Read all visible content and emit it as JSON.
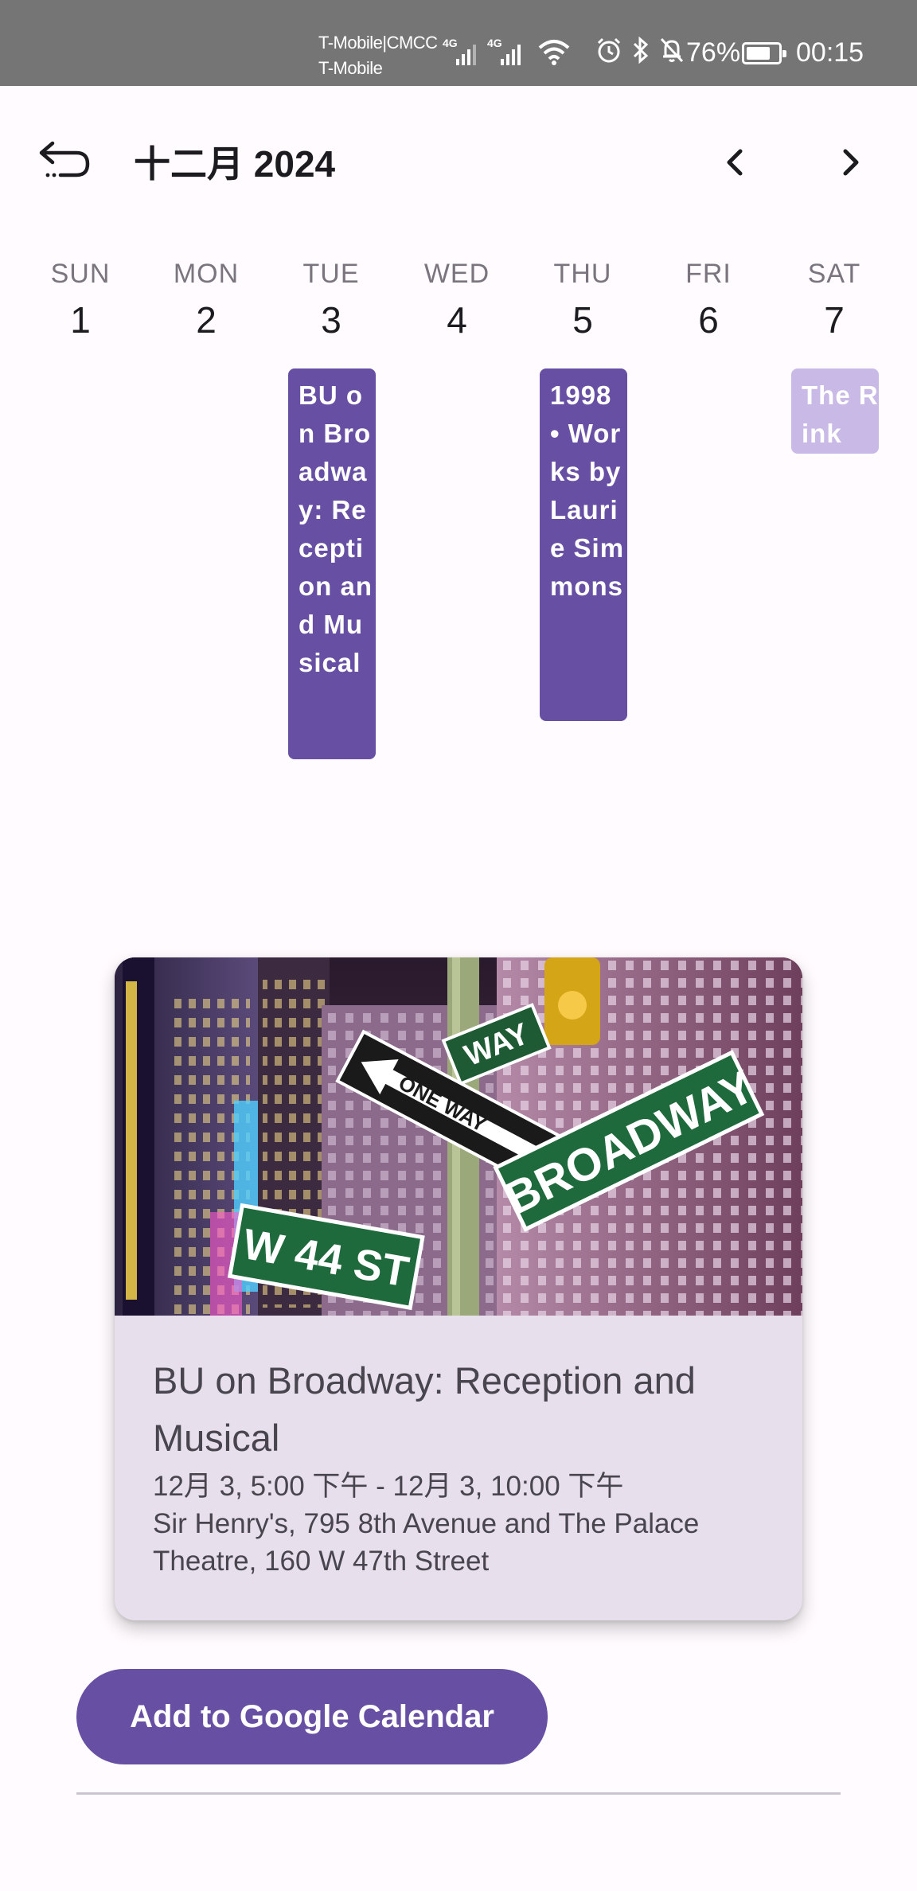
{
  "status_bar": {
    "carrier_1": "T-Mobile|CMCC",
    "carrier_2": "T-Mobile",
    "sim1_label": "4G",
    "sim2_label": "4G",
    "battery_pct": "76%",
    "battery_level": 0.76,
    "time": "00:15"
  },
  "header": {
    "month_title": "十二月 2024",
    "back_icon": "back-arrow-icon",
    "prev_icon": "chevron-left-icon",
    "next_icon": "chevron-right-icon"
  },
  "week": {
    "days": [
      {
        "name": "SUN",
        "num": "1"
      },
      {
        "name": "MON",
        "num": "2"
      },
      {
        "name": "TUE",
        "num": "3"
      },
      {
        "name": "WED",
        "num": "4"
      },
      {
        "name": "THU",
        "num": "5"
      },
      {
        "name": "FRI",
        "num": "6"
      },
      {
        "name": "SAT",
        "num": "7"
      }
    ],
    "events": [
      {
        "text": "BU on Broadway: Reception and Musical"
      },
      {
        "text": "1998 • Works by Laurie Simmons"
      },
      {
        "text": "The Rink"
      }
    ]
  },
  "event_card": {
    "image_sign_1": "ONE WAY",
    "image_sign_1b": "WAY",
    "image_sign_2": "BROADWAY",
    "image_sign_3": "W 44 ST",
    "title": "BU on Broadway: Reception and Musical",
    "time": "12月 3, 5:00 下午 - 12月 3, 10:00 下午",
    "location": "Sir Henry's, 795 8th Avenue and The Palace Theatre, 160 W 47th Street"
  },
  "actions": {
    "add_to_calendar": "Add to Google Calendar"
  },
  "colors": {
    "primary": "#6750a4",
    "primary_light": "#c8b9e6",
    "card_surface": "#e7e0ec",
    "status_bar": "#757575"
  }
}
